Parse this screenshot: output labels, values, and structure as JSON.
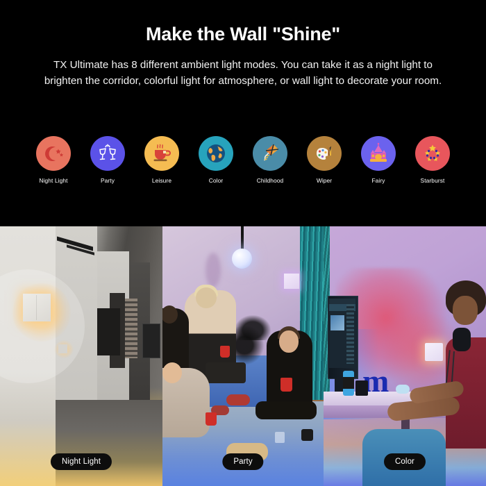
{
  "hero": {
    "title": "Make the Wall \"Shine\"",
    "subtitle": "TX Ultimate has 8 different ambient light modes. You can take it as a night light to brighten the corridor, colorful light for atmosphere, or wall light to decorate your room."
  },
  "modes": [
    {
      "label": "Night Light",
      "icon": "moon-stars-icon",
      "circle_color": "#E8745F",
      "accent_color": "#CE3B36"
    },
    {
      "label": "Party",
      "icon": "cheers-glasses-icon",
      "circle_color": "#5B52E8",
      "accent_color": "#FFFFFF"
    },
    {
      "label": "Leisure",
      "icon": "coffee-cup-icon",
      "circle_color": "#F5BC52",
      "accent_color": "#D8423A"
    },
    {
      "label": "Color",
      "icon": "globe-icon",
      "circle_color": "#27A3BC",
      "accent_color": "#F0A945"
    },
    {
      "label": "Childhood",
      "icon": "kite-icon",
      "circle_color": "#4A8CA8",
      "accent_color": "#F0A33C"
    },
    {
      "label": "Wiper",
      "icon": "paint-palette-icon",
      "circle_color": "#B5823C",
      "accent_color": "#FFFFFF"
    },
    {
      "label": "Fairy",
      "icon": "castle-icon",
      "circle_color": "#6B62EE",
      "accent_color": "#E85BB0"
    },
    {
      "label": "Starburst",
      "icon": "stars-burst-icon",
      "circle_color": "#E8565C",
      "accent_color": "#F5C93A"
    }
  ],
  "panels": [
    {
      "label": "Night Light",
      "scene": "corridor-wall-light"
    },
    {
      "label": "Party",
      "scene": "living-room-party"
    },
    {
      "label": "Color",
      "scene": "desk-gaming-setup"
    }
  ]
}
